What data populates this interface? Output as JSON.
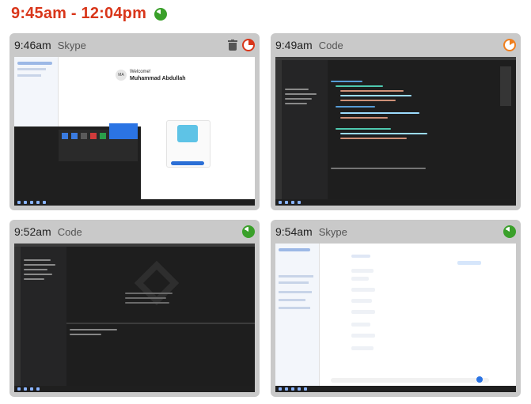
{
  "header": {
    "range": "9:45am - 12:04pm",
    "pie_color": "#3aa02a"
  },
  "cards": [
    {
      "time": "9:46am",
      "app": "Skype",
      "status": "red-ring",
      "has_trash": true
    },
    {
      "time": "9:49am",
      "app": "Code",
      "status": "orange-ring",
      "has_trash": false
    },
    {
      "time": "9:52am",
      "app": "Code",
      "status": "green-pie",
      "has_trash": false
    },
    {
      "time": "9:54am",
      "app": "Skype",
      "status": "green-pie",
      "has_trash": false
    }
  ],
  "skype_welcome": {
    "welcome": "Welcome!",
    "name": "Muhammad Abdullah",
    "initials": "MA"
  },
  "colors": {
    "red": "#d9361a",
    "orange": "#f07f1e",
    "green": "#3aa02a",
    "card_bg": "#c9c9c9"
  }
}
